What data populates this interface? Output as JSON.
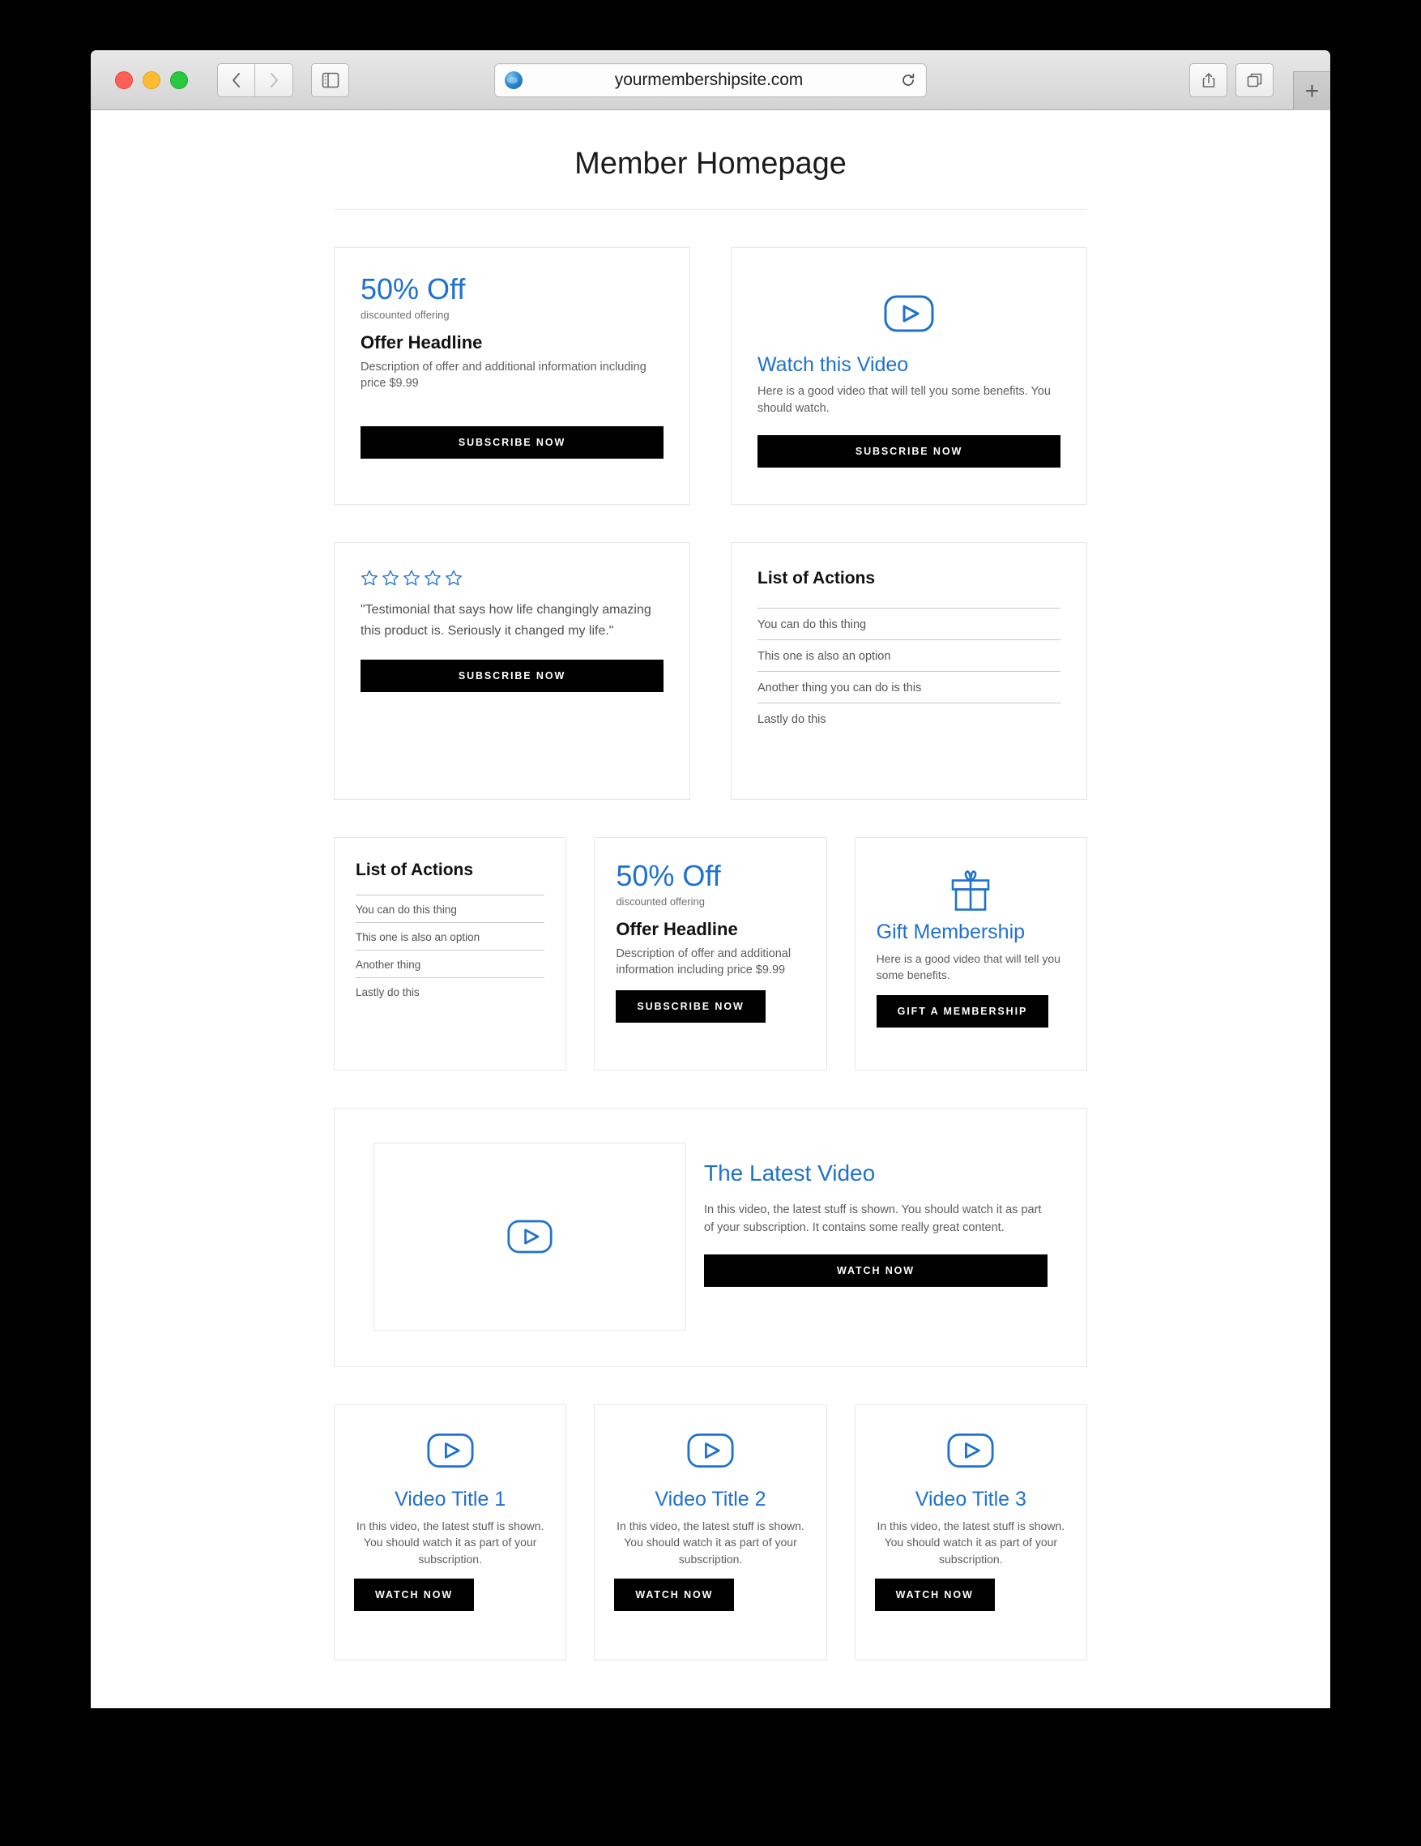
{
  "browser": {
    "url": "yourmembershipsite.com",
    "icons": {
      "back": "back-chevron-icon",
      "forward": "forward-chevron-icon",
      "sidebar": "sidebar-toggle-icon",
      "reload": "reload-icon",
      "share": "share-icon",
      "tabs": "show-all-tabs-icon",
      "new_tab": "+"
    }
  },
  "page": {
    "title": "Member Homepage"
  },
  "offer_card": {
    "percent": "50% Off",
    "sub_label": "discounted offering",
    "headline": "Offer Headline",
    "description": "Description of offer and additional information including price $9.99",
    "button": "SUBSCRIBE NOW"
  },
  "watch_video_card": {
    "icon": "play-video-icon",
    "title": "Watch this Video",
    "description": "Here is a good video that will tell you some benefits. You should watch.",
    "button": "SUBSCRIBE NOW"
  },
  "testimonial_card": {
    "stars": 5,
    "quote": "\"Testimonial that says how life changingly amazing this product is. Seriously it changed my life.\"",
    "button": "SUBSCRIBE NOW"
  },
  "actions_card_wide": {
    "title": "List of Actions",
    "items": [
      "You can do this thing",
      "This one is also an option",
      "Another thing you can do is this",
      "Lastly do this"
    ]
  },
  "actions_card_narrow": {
    "title": "List of Actions",
    "items": [
      "You can do this thing",
      "This one is also an option",
      "Another thing",
      "Lastly do this"
    ]
  },
  "offer_card_small": {
    "percent": "50% Off",
    "sub_label": "discounted offering",
    "headline": "Offer Headline",
    "description": "Description of offer and additional information including price $9.99",
    "button": "SUBSCRIBE NOW"
  },
  "gift_card": {
    "icon": "gift-icon",
    "title": "Gift Membership",
    "description": "Here is a good video that will tell you some benefits.",
    "button": "GIFT A MEMBERSHIP"
  },
  "latest_video": {
    "icon": "play-video-icon",
    "title": "The Latest Video",
    "description": "In this video, the latest stuff is shown. You should watch it as part of your subscription. It contains some really great content.",
    "button": "WATCH NOW"
  },
  "video_cards": [
    {
      "icon": "play-video-icon",
      "title": "Video Title 1",
      "description": "In this video, the latest stuff is shown. You should watch it as part of your subscription.",
      "button": "WATCH NOW"
    },
    {
      "icon": "play-video-icon",
      "title": "Video Title 2",
      "description": "In this video, the latest stuff is shown. You should watch it as part of your subscription.",
      "button": "WATCH NOW"
    },
    {
      "icon": "play-video-icon",
      "title": "Video Title 3",
      "description": "In this video, the latest stuff is shown. You should watch it as part of your subscription.",
      "button": "WATCH NOW"
    }
  ],
  "colors": {
    "accent_blue": "#2071cf",
    "button_black": "#000000",
    "card_border": "#e7e7e7",
    "body_text": "#5d5d5d"
  }
}
